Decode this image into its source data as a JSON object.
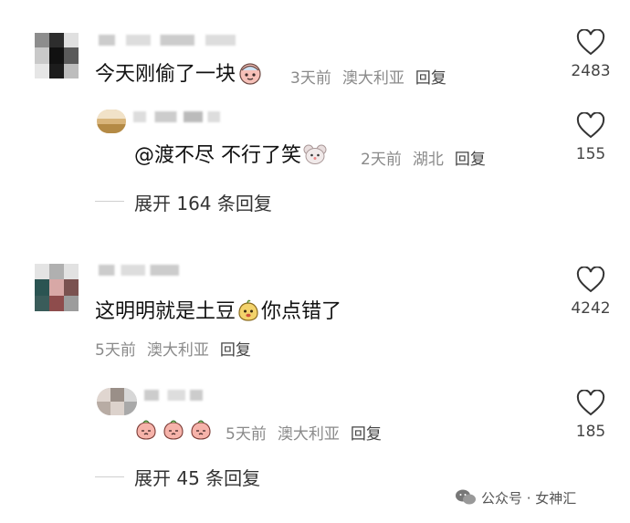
{
  "comments": [
    {
      "text": "今天刚偷了一块",
      "time": "3天前",
      "location": "澳大利亚",
      "reply_label": "回复",
      "likes": "2483",
      "replies": [
        {
          "text": "@渡不尽  不行了笑",
          "time": "2天前",
          "location": "湖北",
          "reply_label": "回复",
          "likes": "155"
        }
      ],
      "expand_label": "展开 164 条回复"
    },
    {
      "text": "这明明就是土豆",
      "text_after": "你点错了",
      "time": "5天前",
      "location": "澳大利亚",
      "reply_label": "回复",
      "likes": "4242",
      "replies": [
        {
          "time": "5天前",
          "location": "澳大利亚",
          "reply_label": "回复",
          "likes": "185"
        }
      ],
      "expand_label": "展开 45 条回复"
    }
  ],
  "watermark": {
    "text": "公众号 · 女神汇"
  },
  "colors": {
    "meta": "#8a8a8a",
    "heart": "#333333",
    "emoji_pink": "#f4a6a0"
  }
}
